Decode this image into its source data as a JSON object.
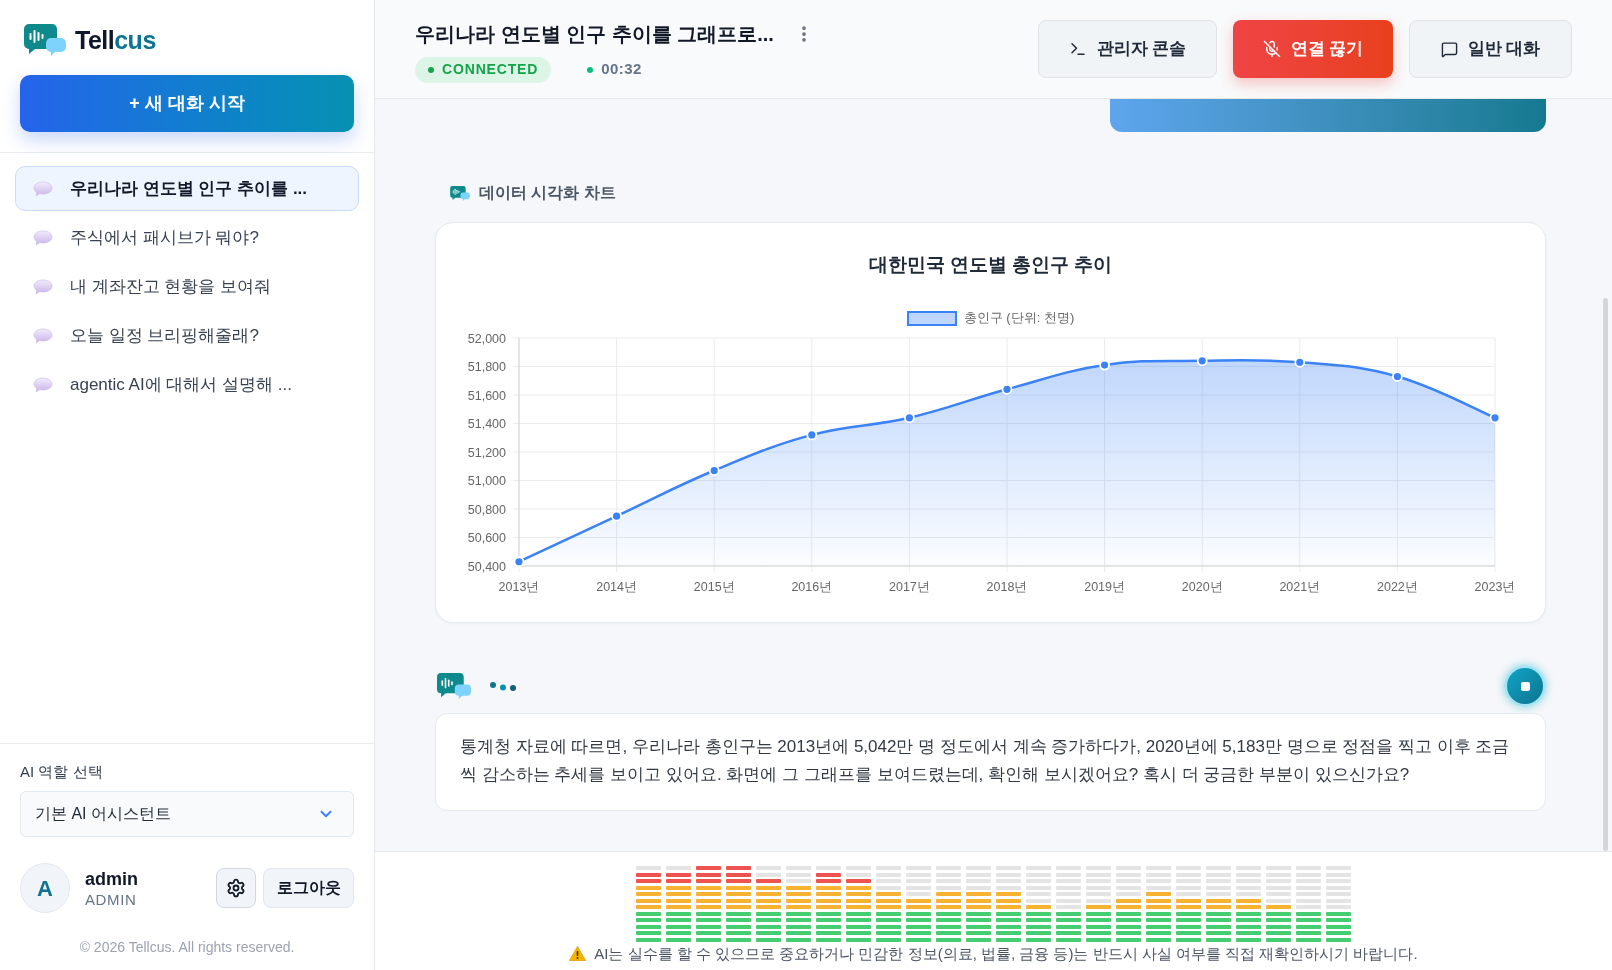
{
  "sidebar": {
    "logo": {
      "text": "Tell",
      "accent": "cus"
    },
    "new_chat_button": "+ 새 대화 시작",
    "conversations": [
      {
        "title": "우리나라 연도별 인구 추이를 ...",
        "selected": true
      },
      {
        "title": "주식에서 패시브가 뭐야?",
        "selected": false
      },
      {
        "title": "내 계좌잔고 현황을 보여줘",
        "selected": false
      },
      {
        "title": "오늘 일정 브리핑해줄래?",
        "selected": false
      },
      {
        "title": "agentic AI에 대해서 설명해 ...",
        "selected": false
      }
    ],
    "role_select": {
      "label": "AI 역할 선택",
      "value": "기본 AI 어시스턴트"
    },
    "user": {
      "avatar_letter": "A",
      "name": "admin",
      "role": "ADMIN"
    },
    "logout_button": "로그아웃",
    "footer": "© 2026 Tellcus. All rights reserved."
  },
  "header": {
    "title": "우리나라 연도별 인구 추이를 그래프로...",
    "status": {
      "label": "CONNECTED",
      "kind": "connected"
    },
    "timer": "00:32",
    "buttons": [
      {
        "label": "관리자 콘솔",
        "kind": "console"
      },
      {
        "label": "연결 끊기",
        "kind": "disconnect"
      },
      {
        "label": "일반 대화",
        "kind": "chat"
      }
    ]
  },
  "chat": {
    "chart_section_label": "데이터 시각화 차트",
    "chart_data": {
      "type": "area",
      "title": "대한민국 연도별 총인구 추이",
      "categories": [
        "2013년",
        "2014년",
        "2015년",
        "2016년",
        "2017년",
        "2018년",
        "2019년",
        "2020년",
        "2021년",
        "2022년",
        "2023년"
      ],
      "series": [
        {
          "name": "총인구 (단위: 천명)",
          "color": "#3b82f6",
          "values": [
            50430,
            50750,
            51070,
            51320,
            51440,
            51640,
            51810,
            51840,
            51830,
            51730,
            51440
          ]
        }
      ],
      "ylim": [
        50400,
        52000
      ],
      "yticks": [
        {
          "value": 50400,
          "label": "50,400"
        },
        {
          "value": 50600,
          "label": "50,600"
        },
        {
          "value": 50800,
          "label": "50,800"
        },
        {
          "value": 51000,
          "label": "51,000"
        },
        {
          "value": 51200,
          "label": "51,200"
        },
        {
          "value": 51400,
          "label": "51,400"
        },
        {
          "value": 51600,
          "label": "51,600"
        },
        {
          "value": 51800,
          "label": "51,800"
        },
        {
          "value": 52000,
          "label": "52,000"
        }
      ],
      "grid": true
    },
    "assistant_typing": true,
    "assistant_message": "통계청 자료에 따르면, 우리나라 총인구는 2013년에 5,042만 명 정도에서 계속 증가하다가, 2020년에 5,183만 명으로 정점을 찍고 이후 조금씩 감소하는 추세를 보이고 있어요. 화면에 그 그래프를 보여드렸는데, 확인해 보시겠어요? 혹시 더 궁금한 부분이 있으신가요?"
  },
  "level_meter": {
    "bars": [
      {
        "level": 0.917
      },
      {
        "level": 0.917
      },
      {
        "level": 1
      },
      {
        "level": 1
      },
      {
        "level": 0.833
      },
      {
        "level": 0.75
      },
      {
        "level": 0.917
      },
      {
        "level": 0.833
      },
      {
        "level": 0.667
      },
      {
        "level": 0.583
      },
      {
        "level": 0.667
      },
      {
        "level": 0.667
      },
      {
        "level": 0.667
      },
      {
        "level": 0.5
      },
      {
        "level": 0.417
      },
      {
        "level": 0.5
      },
      {
        "level": 0.583
      },
      {
        "level": 0.667
      },
      {
        "level": 0.583
      },
      {
        "level": 0.583
      },
      {
        "level": 0.583
      },
      {
        "level": 0.5
      },
      {
        "level": 0.417
      },
      {
        "level": 0.417
      }
    ]
  },
  "disclaimer": "AI는 실수를 할 수 있으므로 중요하거나 민감한 정보(의료, 법률, 금융 등)는 반드시 사실 여부를 직접 재확인하시기 바랍니다."
}
